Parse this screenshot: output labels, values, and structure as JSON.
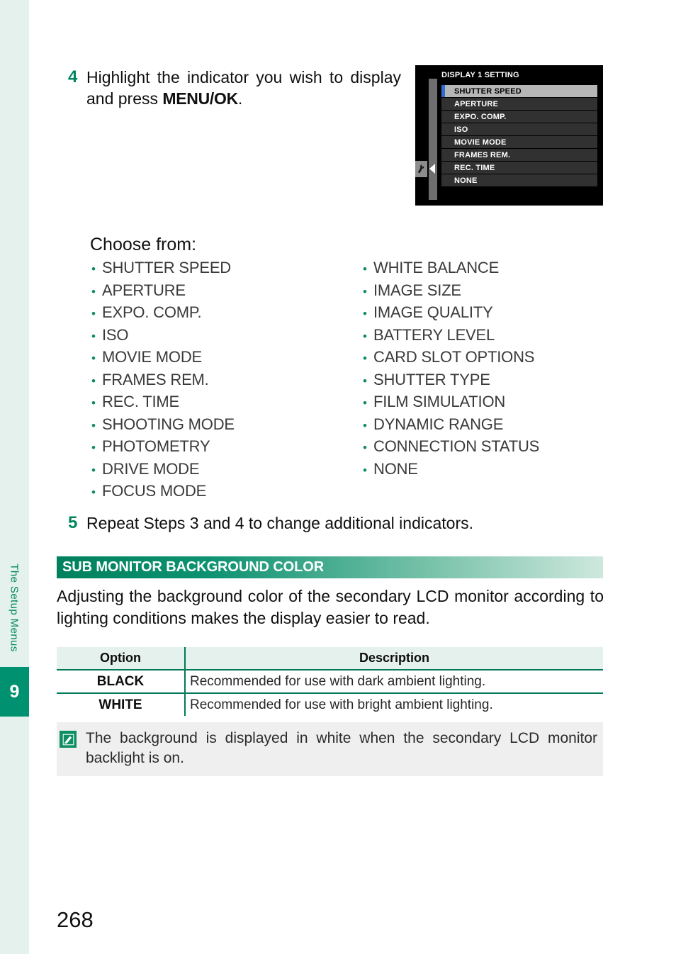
{
  "sidebar": {
    "chapter_label": "The Setup Menus",
    "chapter_number": "9"
  },
  "steps": [
    {
      "number": "4",
      "text_before_bold": "Highlight the indicator you wish to display and press ",
      "bold": "MENU/OK",
      "text_after_bold": "."
    },
    {
      "number": "5",
      "text": "Repeat Steps 3 and 4 to change additional indicators."
    }
  ],
  "camera_menu": {
    "title": "DISPLAY 1 SETTING",
    "tab_icon": "wrench-icon",
    "back_arrow_icon": "left-triangle-icon",
    "items": [
      {
        "label": "SHUTTER SPEED",
        "selected": true
      },
      {
        "label": "APERTURE",
        "selected": false
      },
      {
        "label": "EXPO. COMP.",
        "selected": false
      },
      {
        "label": "ISO",
        "selected": false
      },
      {
        "label": "MOVIE MODE",
        "selected": false
      },
      {
        "label": "FRAMES REM.",
        "selected": false
      },
      {
        "label": "REC. TIME",
        "selected": false
      },
      {
        "label": "NONE",
        "selected": false
      }
    ],
    "colors": {
      "background": "#000000",
      "row": "#313131",
      "row_selected": "#b6b6b6",
      "selection_marker": "#2f6ed0",
      "scrollbar": "#6e6e6e"
    }
  },
  "choose_from": {
    "heading": "Choose from:",
    "left_column": [
      "SHUTTER SPEED",
      "APERTURE",
      "EXPO. COMP.",
      "ISO",
      "MOVIE MODE",
      "FRAMES REM.",
      "REC. TIME",
      "SHOOTING MODE",
      "PHOTOMETRY",
      "DRIVE MODE",
      "FOCUS MODE"
    ],
    "right_column": [
      "WHITE BALANCE",
      "IMAGE SIZE",
      "IMAGE QUALITY",
      "BATTERY LEVEL",
      "CARD SLOT OPTIONS",
      "SHUTTER TYPE",
      "FILM SIMULATION",
      "DYNAMIC RANGE",
      "CONNECTION STATUS",
      "NONE"
    ],
    "bullet_color": "#0f8a68"
  },
  "section": {
    "header_title": "SUB MONITOR BACKGROUND COLOR",
    "intro": "Adjusting the background color of the secondary LCD monitor according to lighting conditions makes the display easier to read.",
    "accent_color": "#00815d"
  },
  "option_table": {
    "headers": [
      "Option",
      "Description"
    ],
    "rows": [
      {
        "option": "BLACK",
        "description": "Recommended for use with dark ambient lighting."
      },
      {
        "option": "WHITE",
        "description": "Recommended for use with bright ambient lighting."
      }
    ]
  },
  "note": {
    "icon": "note-pencil-icon",
    "text": "The background is displayed in white when the secondary LCD monitor backlight is on."
  },
  "page_number": "268"
}
